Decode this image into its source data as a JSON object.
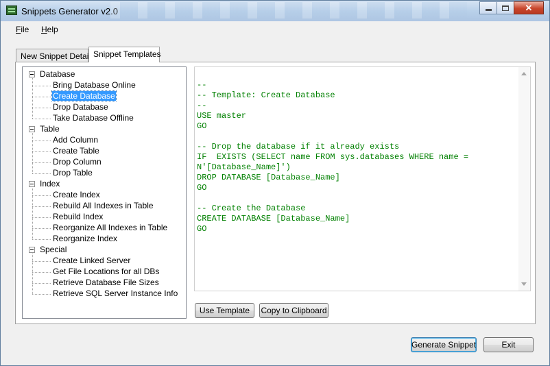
{
  "window": {
    "title": "Snippets Generator v2.0",
    "close_glyph": "✕"
  },
  "menu": {
    "file": "File",
    "help": "Help"
  },
  "tabs": [
    {
      "label": "New Snippet Details",
      "active": false
    },
    {
      "label": "Snippet Templates",
      "active": true
    }
  ],
  "tree": {
    "groups": [
      {
        "label": "Database",
        "children": [
          "Bring Database Online",
          "Create Database",
          "Drop Database",
          "Take Database Offline"
        ]
      },
      {
        "label": "Table",
        "children": [
          "Add Column",
          "Create Table",
          "Drop Column",
          "Drop Table"
        ]
      },
      {
        "label": "Index",
        "children": [
          "Create Index",
          "Rebuild All Indexes in Table",
          "Rebuild Index",
          "Reorganize All Indexes in Table",
          "Reorganize Index"
        ]
      },
      {
        "label": "Special",
        "children": [
          "Create Linked Server",
          "Get File Locations for all DBs",
          "Retrieve Database File Sizes",
          "Retrieve SQL Server Instance Info"
        ]
      }
    ],
    "selected": "Create Database"
  },
  "code": {
    "lines": [
      "--",
      "-- Template: Create Database",
      "--",
      "USE master",
      "GO",
      "",
      "-- Drop the database if it already exists",
      "IF  EXISTS (SELECT name FROM sys.databases WHERE name =",
      "N'[Database_Name]')",
      "DROP DATABASE [Database_Name]",
      "GO",
      "",
      "-- Create the Database",
      "CREATE DATABASE [Database_Name]",
      "GO"
    ],
    "text_color": "#008000"
  },
  "buttons": {
    "use_template": "Use Template",
    "copy_to_clipboard": "Copy to Clipboard",
    "generate_snippet": "Generate Snippet",
    "exit": "Exit"
  }
}
